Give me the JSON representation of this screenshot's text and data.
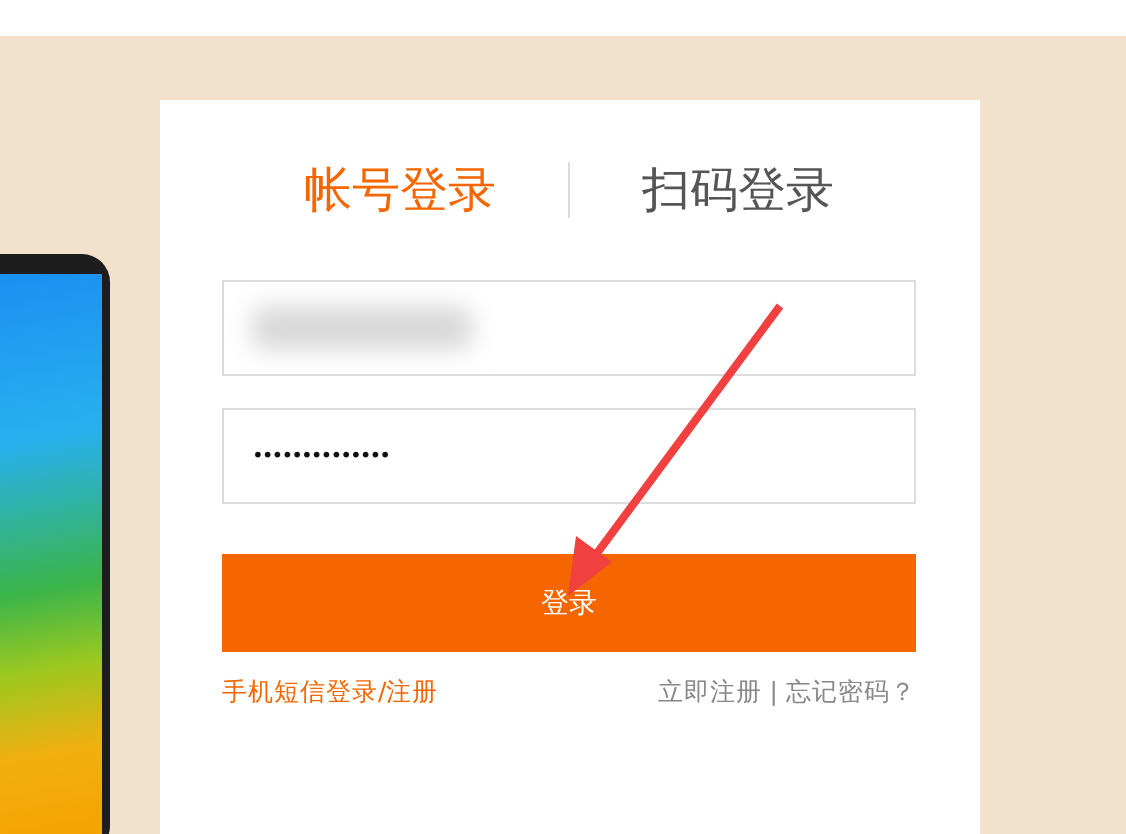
{
  "tabs": [
    {
      "label": "帐号登录",
      "selected": true
    },
    {
      "label": "扫码登录",
      "selected": false
    }
  ],
  "username": {
    "value_blurred": true
  },
  "password": {
    "value": "••••••••••••••"
  },
  "login_button": {
    "label": "登录"
  },
  "links": {
    "left": "手机短信登录/注册",
    "right": [
      {
        "label": "立即注册"
      },
      {
        "label": "忘记密码？"
      }
    ],
    "separator": "|"
  }
}
